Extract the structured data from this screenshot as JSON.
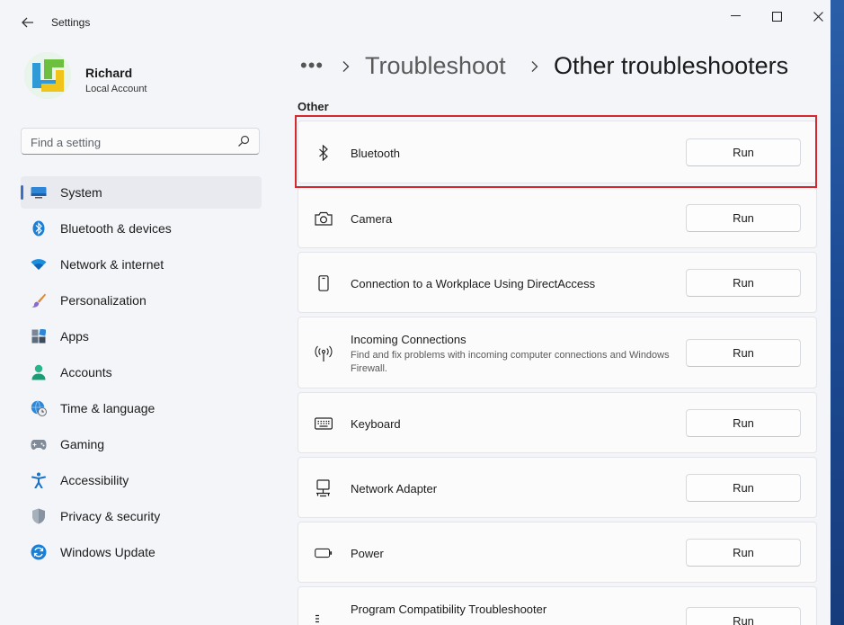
{
  "app": {
    "title": "Settings"
  },
  "user": {
    "name": "Richard",
    "account_type": "Local Account"
  },
  "search": {
    "placeholder": "Find a setting"
  },
  "sidebar": {
    "items": [
      {
        "label": "System",
        "icon": "monitor-icon",
        "active": true
      },
      {
        "label": "Bluetooth & devices",
        "icon": "bluetooth-icon"
      },
      {
        "label": "Network & internet",
        "icon": "wifi-icon"
      },
      {
        "label": "Personalization",
        "icon": "brush-icon"
      },
      {
        "label": "Apps",
        "icon": "apps-icon"
      },
      {
        "label": "Accounts",
        "icon": "person-icon"
      },
      {
        "label": "Time & language",
        "icon": "globe-clock-icon"
      },
      {
        "label": "Gaming",
        "icon": "gamepad-icon"
      },
      {
        "label": "Accessibility",
        "icon": "accessibility-icon"
      },
      {
        "label": "Privacy & security",
        "icon": "shield-icon"
      },
      {
        "label": "Windows Update",
        "icon": "update-icon"
      }
    ]
  },
  "breadcrumb": {
    "dots": "•••",
    "parent": "Troubleshoot",
    "current": "Other troubleshooters"
  },
  "section": {
    "label": "Other"
  },
  "troubleshooters": [
    {
      "title": "Bluetooth",
      "icon": "bluetooth-icon",
      "button": "Run"
    },
    {
      "title": "Camera",
      "icon": "camera-icon",
      "button": "Run"
    },
    {
      "title": "Connection to a Workplace Using DirectAccess",
      "icon": "phone-icon",
      "button": "Run"
    },
    {
      "title": "Incoming Connections",
      "description": "Find and fix problems with incoming computer connections and Windows Firewall.",
      "icon": "antenna-icon",
      "button": "Run"
    },
    {
      "title": "Keyboard",
      "icon": "keyboard-icon",
      "button": "Run"
    },
    {
      "title": "Network Adapter",
      "icon": "network-adapter-icon",
      "button": "Run"
    },
    {
      "title": "Power",
      "icon": "battery-icon",
      "button": "Run"
    },
    {
      "title": "Program Compatibility Troubleshooter",
      "icon": "program-icon",
      "button": "Run"
    }
  ],
  "colors": {
    "accent": "#3a6fc4",
    "highlight": "#d42a2f"
  }
}
